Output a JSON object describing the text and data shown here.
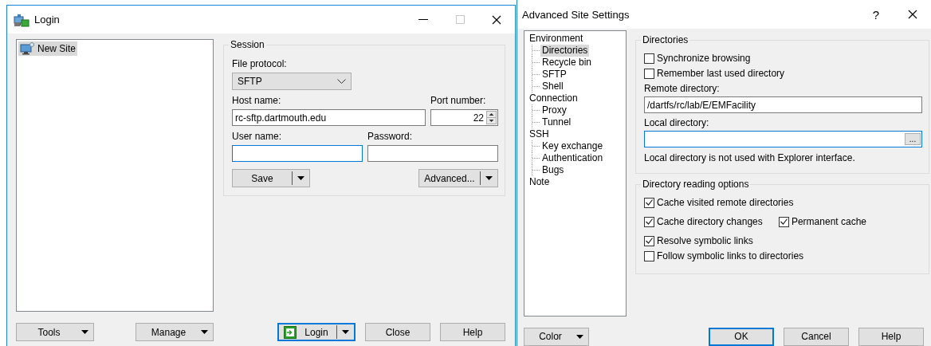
{
  "login_window": {
    "title": "Login",
    "maximize_disabled": true,
    "site_tree": [
      {
        "label": "New Site",
        "selected": true
      }
    ],
    "session": {
      "legend": "Session",
      "file_protocol": {
        "label": "File protocol:",
        "value": "SFTP"
      },
      "host_name": {
        "label": "Host name:",
        "value": "rc-sftp.dartmouth.edu"
      },
      "port_number": {
        "label": "Port number:",
        "value": "22"
      },
      "user_name": {
        "label": "User name:",
        "focused": true
      },
      "password": {
        "label": "Password:",
        "focused": false
      },
      "save_button": "Save",
      "advanced_button": "Advanced..."
    },
    "site_buttons": [
      {
        "label": "Tools",
        "kind": "dropdown",
        "default": false
      },
      {
        "label": "Manage",
        "kind": "dropdown",
        "default": false
      }
    ],
    "dialog_buttons": [
      {
        "label": "Login",
        "kind": "split",
        "default": true
      },
      {
        "label": "Close",
        "kind": "plain",
        "default": false
      },
      {
        "label": "Help",
        "kind": "plain",
        "default": false
      }
    ]
  },
  "advanced_window": {
    "title": "Advanced Site Settings",
    "help_glyph": "?",
    "tree": [
      {
        "label": "Environment",
        "selected": false,
        "children": [
          {
            "label": "Directories",
            "selected": true
          },
          {
            "label": "Recycle bin",
            "selected": false
          },
          {
            "label": "SFTP",
            "selected": false
          },
          {
            "label": "Shell",
            "selected": false
          }
        ]
      },
      {
        "label": "Connection",
        "selected": false,
        "children": [
          {
            "label": "Proxy",
            "selected": false
          },
          {
            "label": "Tunnel",
            "selected": false
          }
        ]
      },
      {
        "label": "SSH",
        "selected": false,
        "children": [
          {
            "label": "Key exchange",
            "selected": false
          },
          {
            "label": "Authentication",
            "selected": false
          },
          {
            "label": "Bugs",
            "selected": false
          }
        ]
      },
      {
        "label": "Note",
        "selected": false
      }
    ],
    "directories": {
      "legend": "Directories",
      "checkboxes": [
        {
          "label": "Synchronize browsing",
          "checked": false
        },
        {
          "label": "Remember last used directory",
          "checked": false
        }
      ],
      "remote_directory": {
        "label": "Remote directory:",
        "value": "/dartfs/rc/lab/E/EMFacility"
      },
      "local_directory": {
        "label": "Local directory:",
        "focused": true,
        "browse_button": "..."
      },
      "note": "Local directory is not used with Explorer interface."
    },
    "reading_options": {
      "legend": "Directory reading options",
      "checkboxes": [
        {
          "label": "Cache visited remote directories",
          "checked": true
        },
        {
          "label": "Cache directory changes",
          "checked": true,
          "children": [
            {
              "label": "Permanent cache",
              "checked": true
            }
          ]
        },
        {
          "label": "Resolve symbolic links",
          "checked": true
        },
        {
          "label": "Follow symbolic links to directories",
          "checked": false
        }
      ]
    },
    "left_buttons": [
      {
        "label": "Color",
        "kind": "dropdown",
        "default": false
      }
    ],
    "dialog_buttons": [
      {
        "label": "OK",
        "kind": "plain",
        "default": true
      },
      {
        "label": "Cancel",
        "kind": "plain",
        "default": false
      },
      {
        "label": "Help",
        "kind": "plain",
        "default": false
      }
    ]
  }
}
